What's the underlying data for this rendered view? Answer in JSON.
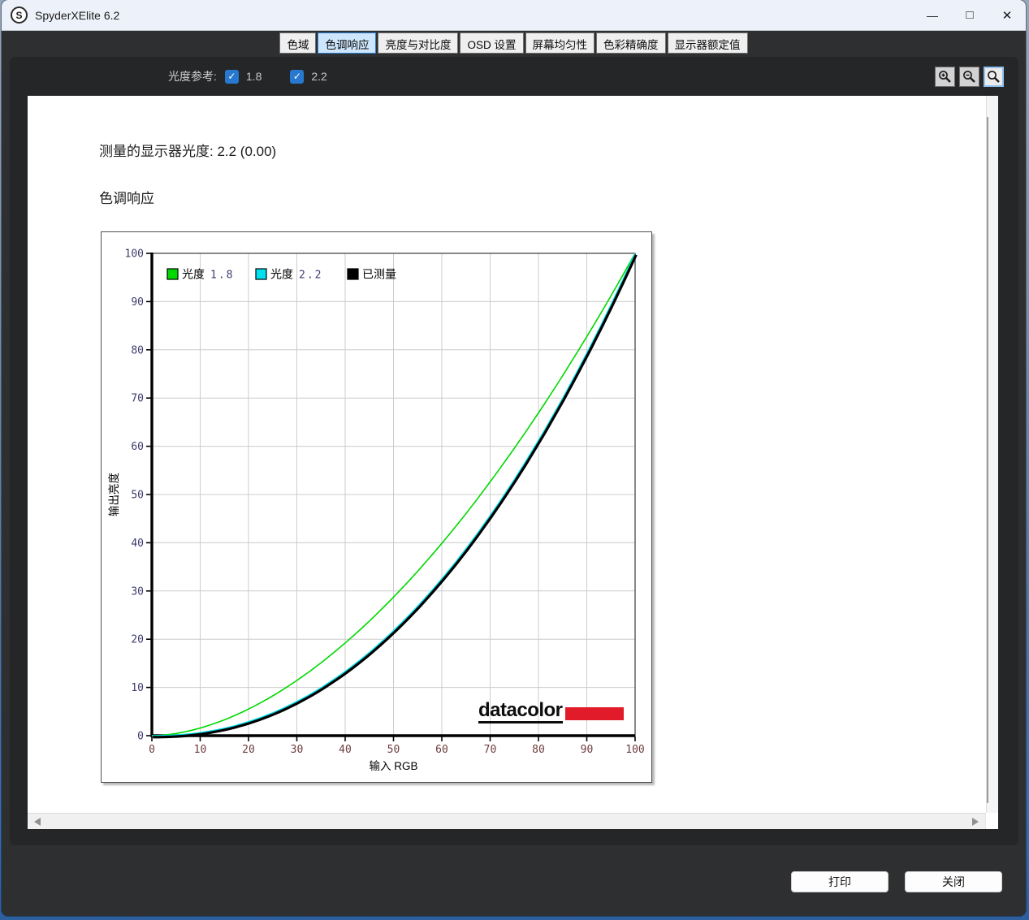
{
  "window": {
    "title": "SpyderXElite 6.2",
    "logo_letter": "S",
    "controls": {
      "minimize": "—",
      "maximize": "□",
      "close": "✕"
    }
  },
  "tabs": {
    "selected_index": 1,
    "items": [
      "色域",
      "色调响应",
      "亮度与对比度",
      "OSD 设置",
      "屏幕均匀性",
      "色彩精确度",
      "显示器额定值"
    ]
  },
  "toolbar": {
    "label": "光度参考:",
    "check_glyph": "✓",
    "checkboxes": [
      {
        "label": "1.8",
        "checked": true
      },
      {
        "label": "2.2",
        "checked": true
      }
    ],
    "zoom_buttons": [
      {
        "name": "zoom-in",
        "selected": false
      },
      {
        "name": "zoom-out",
        "selected": false
      },
      {
        "name": "zoom-fit",
        "selected": true
      }
    ]
  },
  "content": {
    "measured_line": "测量的显示器光度: 2.2 (0.00)",
    "section_title": "色调响应"
  },
  "chart_data": {
    "type": "line",
    "title": "色调响应",
    "xlabel": "输入 RGB",
    "ylabel": "输出亮度",
    "xlim": [
      0,
      100
    ],
    "ylim": [
      0,
      100
    ],
    "xticks": [
      0,
      10,
      20,
      30,
      40,
      50,
      60,
      70,
      80,
      90,
      100
    ],
    "yticks": [
      0,
      10,
      20,
      30,
      40,
      50,
      60,
      70,
      80,
      90,
      100
    ],
    "grid": true,
    "grid_color": "#cccccc",
    "frame_color": "#555555",
    "axis_color": "#000000",
    "xtick_color": "#6e3c3c",
    "ytick_color": "#3c3c6e",
    "legend_position": "top-left-inside",
    "legend": [
      {
        "label": "光度",
        "value": "1.8",
        "swatch": "#00d900"
      },
      {
        "label": "光度",
        "value": "2.2",
        "swatch": "#00e0ee"
      },
      {
        "label": "已测量",
        "value": "",
        "swatch": "#000000"
      }
    ],
    "series": [
      {
        "name": "光度 1.8",
        "curve": "gamma",
        "gamma": 1.8,
        "color": "#00d900",
        "width": 1.6
      },
      {
        "name": "光度 2.2",
        "curve": "gamma",
        "gamma": 2.2,
        "color": "#00e0ee",
        "width": 1.6
      },
      {
        "name": "已测量",
        "curve": "gamma",
        "gamma": 2.2,
        "color": "#000000",
        "width": 3.2,
        "draw_offset": [
          1.3,
          1.8
        ]
      }
    ],
    "watermark": "datacolor"
  },
  "footer": {
    "print_label": "打印",
    "close_label": "关闭"
  }
}
